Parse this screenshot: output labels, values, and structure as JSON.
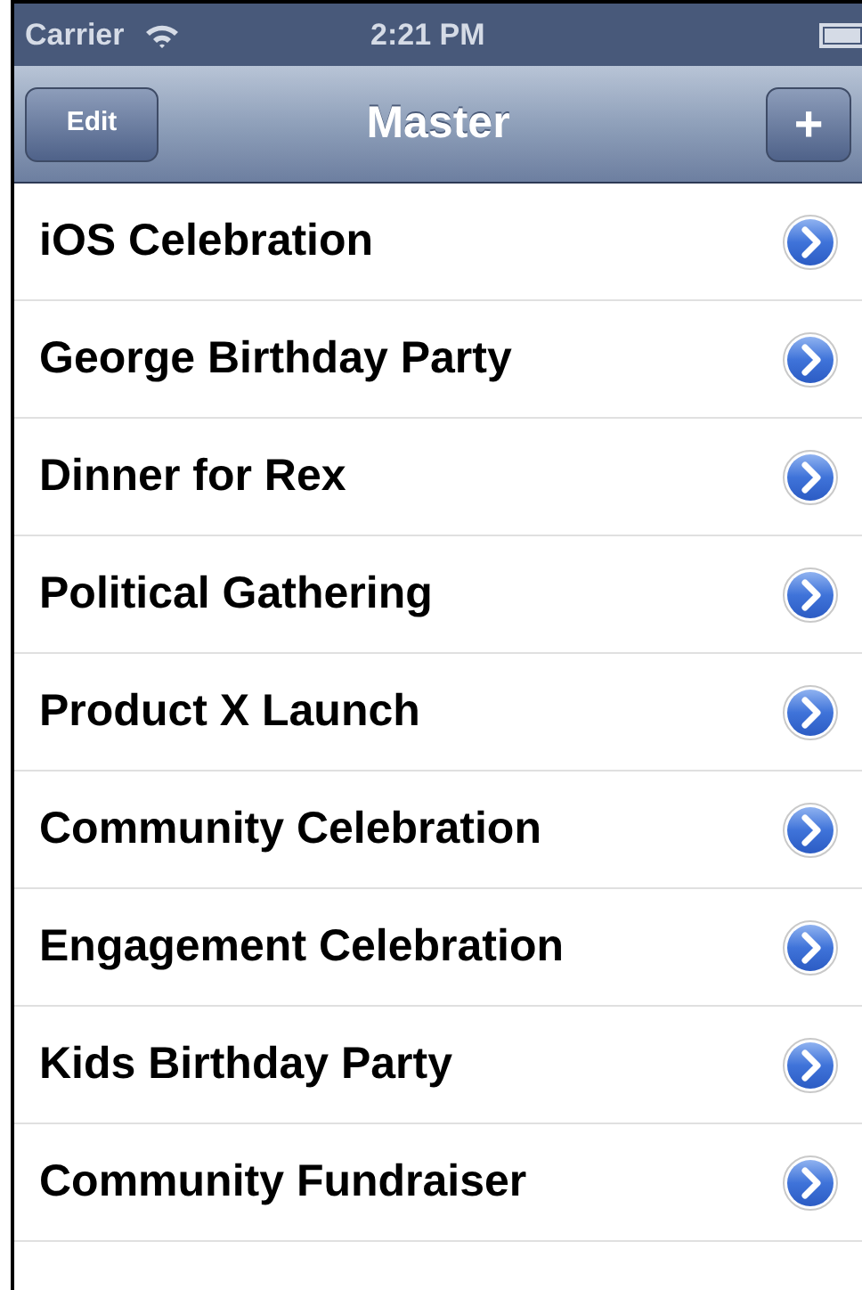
{
  "status_bar": {
    "carrier": "Carrier",
    "time": "2:21 PM"
  },
  "nav_bar": {
    "left_button": "Edit",
    "title": "Master",
    "right_button": "+"
  },
  "rows": [
    {
      "title": "iOS Celebration"
    },
    {
      "title": "George Birthday Party"
    },
    {
      "title": "Dinner for Rex"
    },
    {
      "title": "Political Gathering"
    },
    {
      "title": "Product X Launch"
    },
    {
      "title": "Community Celebration"
    },
    {
      "title": "Engagement Celebration"
    },
    {
      "title": "Kids Birthday Party"
    },
    {
      "title": "Community Fundraiser"
    }
  ]
}
